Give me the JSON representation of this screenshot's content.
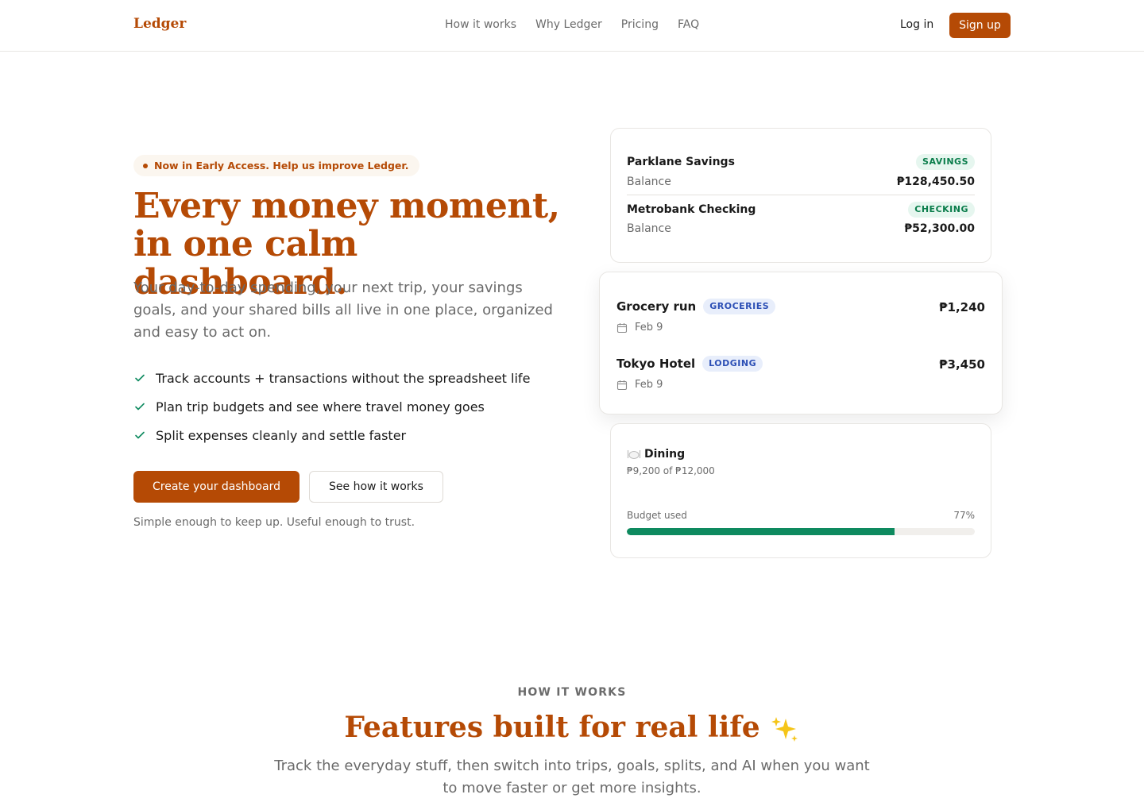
{
  "nav": {
    "logo": "Ledger",
    "links": [
      "How it works",
      "Why Ledger",
      "Pricing",
      "FAQ"
    ],
    "login_label": "Log in",
    "signup_label": "Sign up"
  },
  "hero": {
    "badge": "Now in Early Access. Help us improve Ledger.",
    "title_line1": "Every money moment,",
    "title_line2": "in one calm dashboard.",
    "subtitle": "Your day-to-day spending, your next trip, your savings goals, and your shared bills all live in one place, organized and easy to act on.",
    "checks": [
      "Track accounts + transactions without the spreadsheet life",
      "Plan trip budgets and see where travel money goes",
      "Split expenses cleanly and settle faster"
    ],
    "primary_cta": "Create your dashboard",
    "secondary_cta": "See how it works",
    "tagline": "Simple enough to keep up. Useful enough to trust."
  },
  "accounts": [
    {
      "name": "Parklane Savings",
      "tag": "SAVINGS",
      "label": "Balance",
      "value": "₱128,450.50"
    },
    {
      "name": "Metrobank Checking",
      "tag": "CHECKING",
      "label": "Balance",
      "value": "₱52,300.00"
    }
  ],
  "transactions": [
    {
      "name": "Grocery run",
      "tag": "GROCERIES",
      "date": "Feb 9",
      "amount": "₱1,240"
    },
    {
      "name": "Tokyo Hotel",
      "tag": "LODGING",
      "date": "Feb 9",
      "amount": "₱3,450"
    }
  ],
  "budget": {
    "category": "Dining",
    "summary": "₱9,200 of ₱12,000",
    "used_label": "Budget used",
    "percent_label": "77%",
    "percent": 77
  },
  "how_it_works": {
    "eyebrow": "HOW IT WORKS",
    "title": "Features built for real life",
    "subtitle": "Track the everyday stuff, then switch into trips, goals, splits, and AI when you want to move faster or get more insights."
  },
  "colors": {
    "brand": "#b54a05",
    "success": "#0e8a5f",
    "muted": "#6b6b6b"
  },
  "icons": [
    "check-icon",
    "calendar-icon",
    "dining-icon",
    "sparkle-icon"
  ]
}
